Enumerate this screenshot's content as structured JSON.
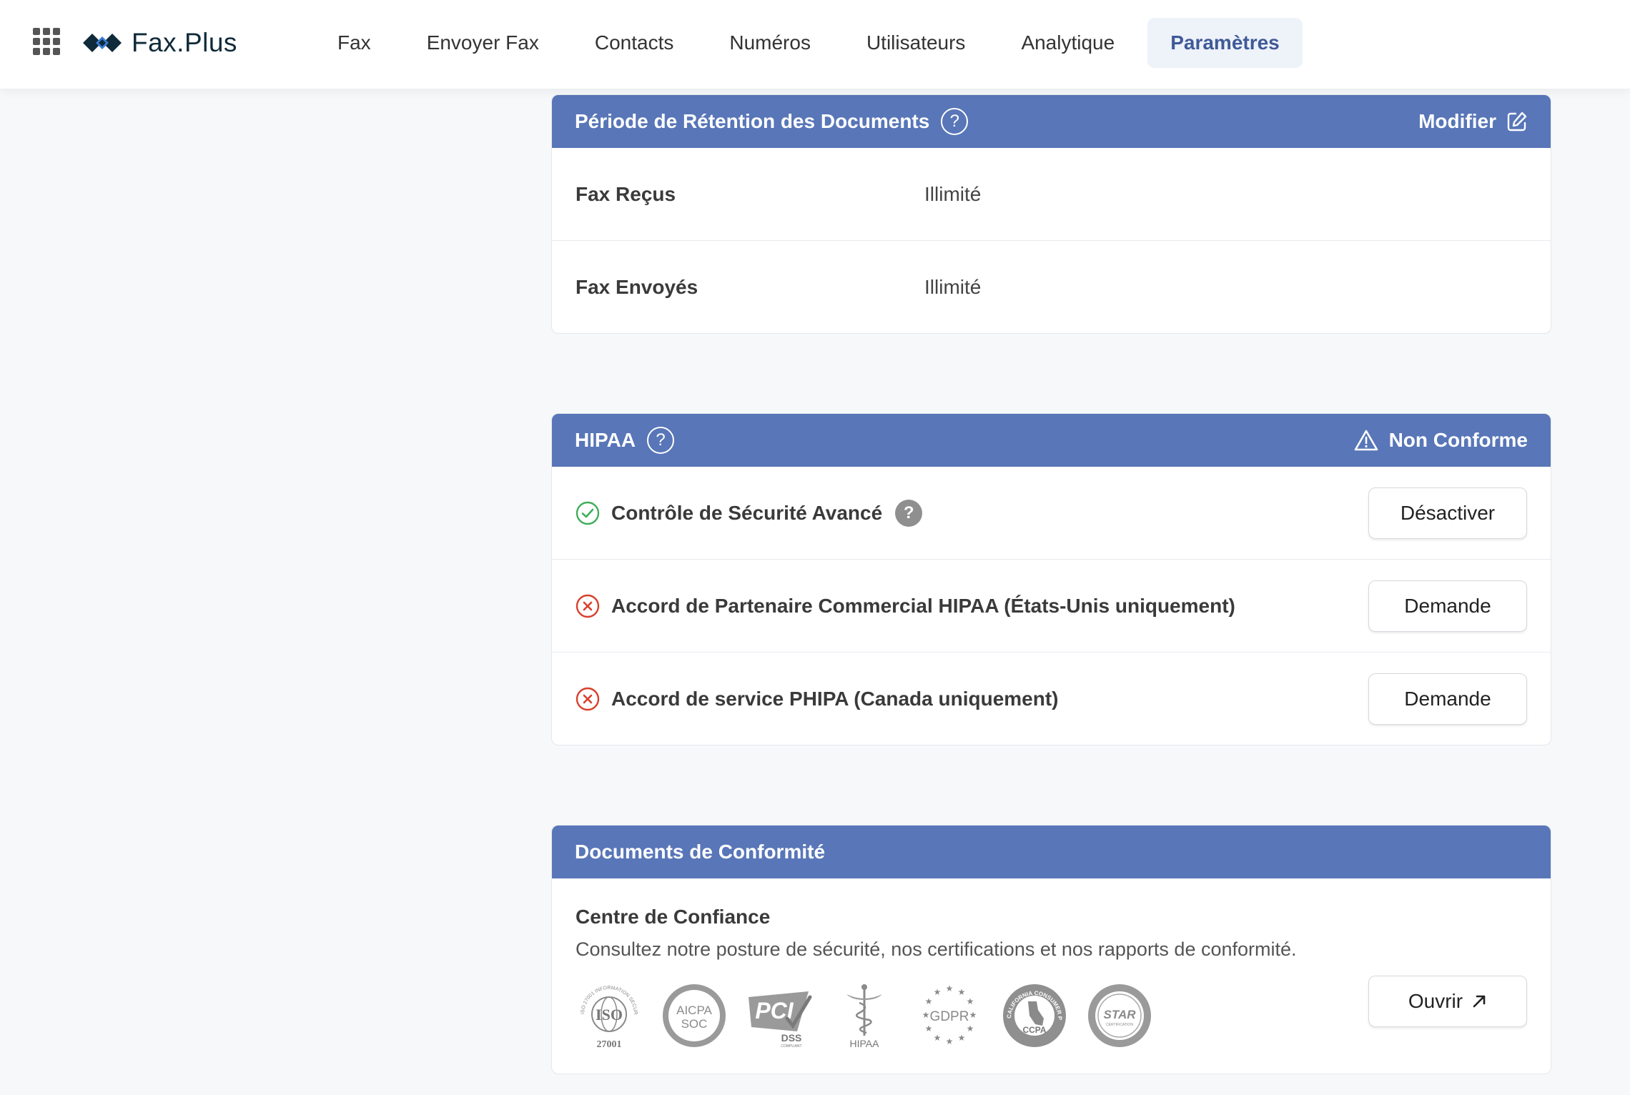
{
  "app": {
    "name": "Fax.Plus"
  },
  "nav": {
    "items": [
      "Fax",
      "Envoyer Fax",
      "Contacts",
      "Numéros",
      "Utilisateurs",
      "Analytique",
      "Paramètres"
    ],
    "active": "Paramètres"
  },
  "colors": {
    "header_blue": "#5876b8",
    "active_nav": "#3f5a98",
    "success": "#3fae5a",
    "error": "#d9402b"
  },
  "retention": {
    "title": "Période de Rétention des Documents",
    "action": "Modifier",
    "rows": [
      {
        "label": "Fax Reçus",
        "value": "Illimité"
      },
      {
        "label": "Fax Envoyés",
        "value": "Illimité"
      }
    ]
  },
  "hipaa": {
    "title": "HIPAA",
    "status": "Non Conforme",
    "rows": [
      {
        "label": "Contrôle de Sécurité Avancé",
        "state": "enabled",
        "button": "Désactiver"
      },
      {
        "label": "Accord de Partenaire Commercial HIPAA (États-Unis uniquement)",
        "state": "missing",
        "button": "Demande"
      },
      {
        "label": "Accord de service PHIPA (Canada uniquement)",
        "state": "missing",
        "button": "Demande"
      }
    ]
  },
  "compliance": {
    "title": "Documents de Conformité",
    "trust_title": "Centre de Confiance",
    "trust_desc": "Consultez notre posture de sécurité, nos certifications et nos rapports de conformité.",
    "open_button": "Ouvrir",
    "badges": {
      "iso": {
        "big": "ISO",
        "num": "27001",
        "ring": "ISO 27001 INFORMATION SECURITY"
      },
      "soc": {
        "line1": "AICPA",
        "line2": "SOC"
      },
      "pci": {
        "big": "PCI",
        "sub": "DSS",
        "tiny": "COMPLIANT"
      },
      "hipaa": {
        "text": "HIPAA"
      },
      "gdpr": {
        "text": "GDPR"
      },
      "ccpa": {
        "text": "CCPA",
        "ring": "CALIFORNIA CONSUMER PRIVACY ACT"
      },
      "star": {
        "text": "STAR",
        "sub": "CERTIFICATION"
      }
    }
  }
}
